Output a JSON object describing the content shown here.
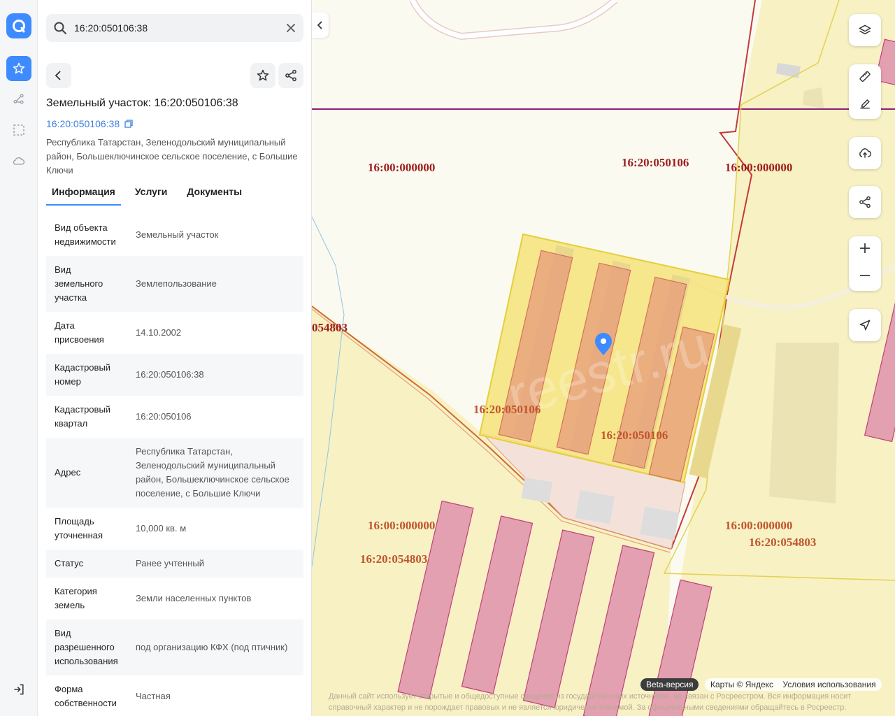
{
  "search": {
    "value": "16:20:050106:38"
  },
  "panel": {
    "title": "Земельный участок: 16:20:050106:38",
    "cadastral_link": "16:20:050106:38",
    "address": "Республика Татарстан, Зеленодольский муниципальный район, Большеключинское сельское поселение, с Большие Ключи",
    "tabs": [
      "Информация",
      "Услуги",
      "Документы"
    ],
    "info": [
      {
        "key": "Вид объекта недвижимости",
        "value": "Земельный участок"
      },
      {
        "key": "Вид земельного участка",
        "value": "Землепользование"
      },
      {
        "key": "Дата присвоения",
        "value": "14.10.2002"
      },
      {
        "key": "Кадастровый номер",
        "value": "16:20:050106:38"
      },
      {
        "key": "Кадастровый квартал",
        "value": "16:20:050106"
      },
      {
        "key": "Адрес",
        "value": "Республика Татарстан, Зеленодольский муниципальный район, Большеключинское сельское поселение, с Большие Ключи"
      },
      {
        "key": "Площадь уточненная",
        "value": "10,000 кв. м"
      },
      {
        "key": "Статус",
        "value": "Ранее учтенный"
      },
      {
        "key": "Категория земель",
        "value": "Земли населенных пунктов"
      },
      {
        "key": "Вид разрешенного использования",
        "value": "под организацию КФХ (под птичник)"
      },
      {
        "key": "Форма собственности",
        "value": "Частная"
      }
    ]
  },
  "map": {
    "labels": [
      "16:00:000000",
      "16:20:050106",
      "16:00:000000",
      "054803",
      "16:20:050106",
      "16:20:050106",
      "16:00:000000",
      "16:20:054803",
      "16:00:000000",
      "16:20:054803"
    ],
    "beta_label": "Beta-версия",
    "copyright": "Карты © Яндекс",
    "terms": "Условия использования",
    "watermark": "reestr.ru",
    "note": "Данный сайт использует открытые и общедоступные сведения из государственных источников, не связан с Росреестром. Вся информация носит справочный характер и не порождает правовых и не является юридически значимой. За официальными сведениями обращайтесь в Росреестр."
  },
  "colors": {
    "accent": "#3d8bff",
    "parcel": "#f5e27a",
    "building": "#e38f9d"
  }
}
